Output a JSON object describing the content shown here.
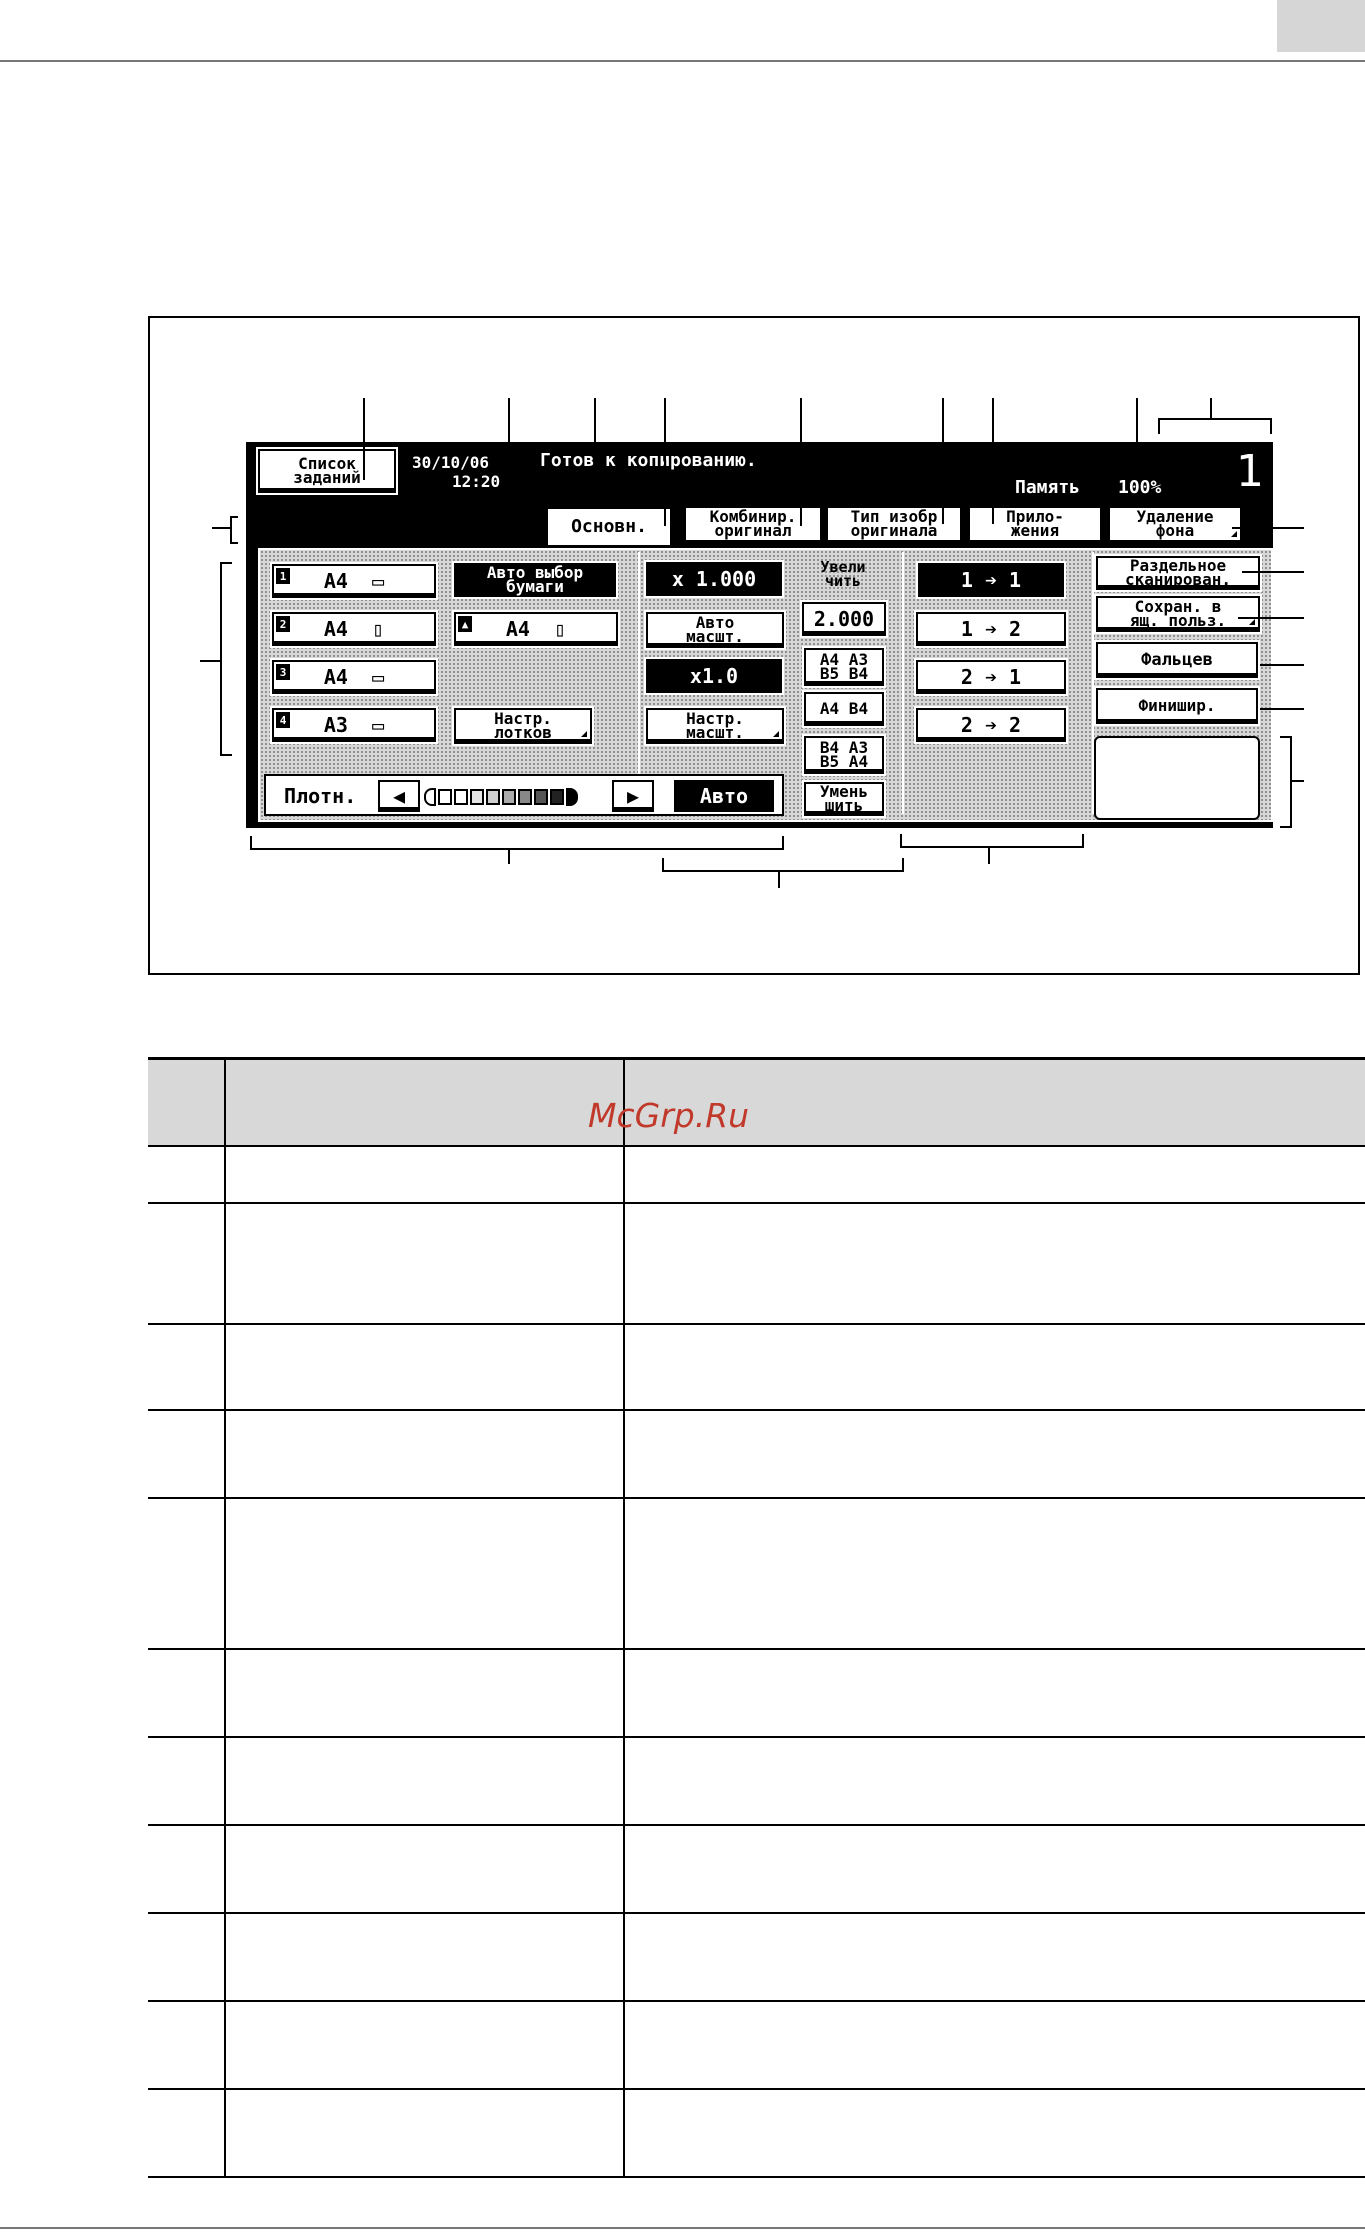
{
  "watermark": "McGrp.Ru",
  "screen": {
    "job_list": [
      "Список",
      "заданий"
    ],
    "date": "30/10/06",
    "time": "12:20",
    "status": "Готов к копированию.",
    "memory_label": "Память",
    "memory_value": "100%",
    "copies": "1",
    "tabs": [
      {
        "lines": [
          "Основн."
        ]
      },
      {
        "lines": [
          "Комбинир.",
          "оригинал"
        ]
      },
      {
        "lines": [
          "Тип изобр",
          "оригинала"
        ]
      },
      {
        "lines": [
          "Прило-",
          "жения"
        ]
      },
      {
        "lines": [
          "Удаление",
          "фона"
        ]
      }
    ],
    "paper": {
      "tray1": {
        "num": "1",
        "label": "A4"
      },
      "tray2": {
        "num": "2",
        "label": "A4"
      },
      "tray3": {
        "num": "3",
        "label": "A4"
      },
      "tray4": {
        "num": "4",
        "label": "A3"
      },
      "bypass": {
        "label": "A4"
      },
      "auto_paper": [
        "Авто выбор",
        "бумаги"
      ],
      "tray_settings": [
        "Настр.",
        "лотков"
      ]
    },
    "zoom": {
      "value": "x 1.000",
      "auto": [
        "Авто",
        "масшт."
      ],
      "x1": "x1.0",
      "settings": [
        "Настр.",
        "масшт."
      ],
      "enlarge_label": [
        "Увели",
        "чить"
      ],
      "z2": "2.000",
      "a4b5": [
        "A4 A3",
        "B5 B4"
      ],
      "a4b4": "A4 B4",
      "b4a3": [
        "B4 A3",
        "B5 A4"
      ],
      "reduce": [
        "Умень",
        "шить"
      ]
    },
    "duplex": [
      "1 ➔ 1",
      "1 ➔ 2",
      "2 ➔ 1",
      "2 ➔ 2"
    ],
    "right_buttons": {
      "separate_scan": [
        "Раздельное",
        "сканирован."
      ],
      "save_box": [
        "Сохран. в",
        "ящ. польз."
      ],
      "fold": "Фальцев",
      "finish": "Финишир."
    },
    "density": {
      "label": "Плотн.",
      "auto": "Авто"
    }
  }
}
